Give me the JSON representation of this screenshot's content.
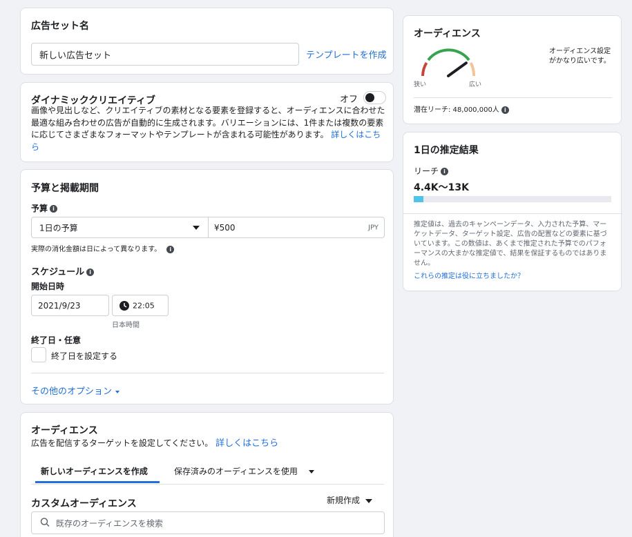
{
  "adset": {
    "title": "広告セット名",
    "name_value": "新しい広告セット",
    "template_link": "テンプレートを作成"
  },
  "dynamic": {
    "title": "ダイナミッククリエイティブ",
    "toggle_label": "オフ",
    "description": "画像や見出しなど、クリエイティブの素材となる要素を登録すると、オーディエンスに合わせた最適な組み合わせの広告が自動的に生成されます。バリエーションには、1件または複数の要素に応じてさまざまなフォーマットやテンプレートが含まれる可能性があります。",
    "learn_more": "詳しくはこちら"
  },
  "budget": {
    "title": "予算と掲載期間",
    "budget_label": "予算",
    "budget_type": "1日の予算",
    "amount": "¥500",
    "currency": "JPY",
    "note": "実際の消化金額は日によって異なります。",
    "schedule_label": "スケジュール",
    "start_label": "開始日時",
    "start_date": "2021/9/23",
    "start_time": "22:05",
    "timezone": "日本時間",
    "end_label": "終了日・任意",
    "end_checkbox_label": "終了日を設定する",
    "more_options": "その他のオプション"
  },
  "audience_section": {
    "title": "オーディエンス",
    "description": "広告を配信するターゲットを設定してください。",
    "learn_more": "詳しくはこちら",
    "tabs": [
      {
        "label": "新しいオーディエンスを作成",
        "active": true
      },
      {
        "label": "保存済みのオーディエンスを使用",
        "active": false
      }
    ],
    "custom_title": "カスタムオーディエンス",
    "create_new": "新規作成",
    "search_placeholder": "既存のオーディエンスを検索"
  },
  "audience_panel": {
    "title": "オーディエンス",
    "gauge_narrow": "狭い",
    "gauge_wide": "広い",
    "gauge_level": 0.8,
    "status_text": "オーディエンス設定がかなり広いです。",
    "reach_text": "潜在リーチ: 48,000,000人"
  },
  "estimate_panel": {
    "title": "1日の推定結果",
    "reach_label": "リーチ",
    "reach_value": "4.4K〜13K",
    "reach_fraction": 0.05,
    "disclaimer": "推定値は、過去のキャンペーンデータ、入力された予算、マーケットデータ、ターゲット設定、広告の配置などの要素に基づいています。この数値は、あくまで推定された予算でのパフォーマンスの大まかな推定値で、結果を保証するものではありません。",
    "feedback_link": "これらの推定は役に立ちましたか？"
  },
  "colors": {
    "link": "#216fdb",
    "gauge_red": "#c7433c",
    "gauge_green": "#36a44c",
    "gauge_orange": "#f3c399",
    "bar_fill": "#4fc3e8"
  }
}
